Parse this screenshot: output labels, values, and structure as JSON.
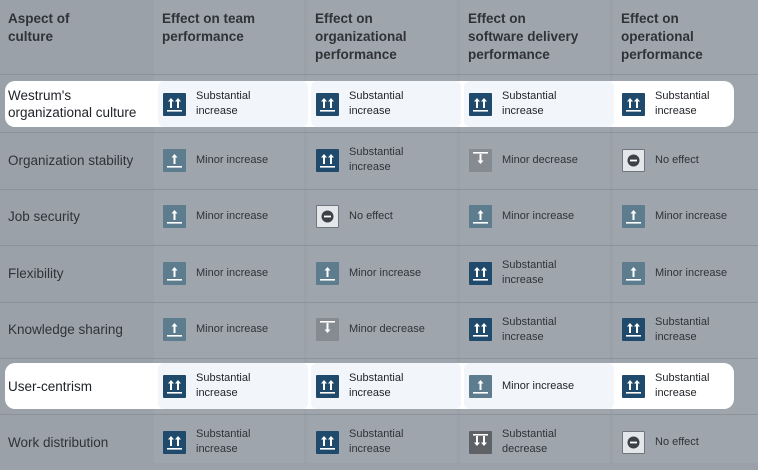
{
  "headers": [
    "Aspect of\nculture",
    "Effect on team\nperformance",
    "Effect on\norganizational\nperformance",
    "Effect on\nsoftware delivery\nperformance",
    "Effect on\noperational\nperformance"
  ],
  "colors": {
    "substantial_increase": "#1f4a6b",
    "minor_increase": "#5d7d8f",
    "minor_decrease": "#868b91",
    "substantial_decrease": "#5e6267",
    "no_effect": "#e4e7ea"
  },
  "rows": [
    {
      "aspect": "Westrum's organizational culture",
      "highlight": true,
      "cells": [
        {
          "label": "Substantial increase",
          "icon": "substantial-increase-icon"
        },
        {
          "label": "Substantial increase",
          "icon": "substantial-increase-icon"
        },
        {
          "label": "Substantial increase",
          "icon": "substantial-increase-icon"
        },
        {
          "label": "Substantial increase",
          "icon": "substantial-increase-icon"
        }
      ]
    },
    {
      "aspect": "Organization stability",
      "highlight": false,
      "cells": [
        {
          "label": "Minor increase",
          "icon": "minor-increase-icon"
        },
        {
          "label": "Substantial increase",
          "icon": "substantial-increase-icon"
        },
        {
          "label": "Minor decrease",
          "icon": "minor-decrease-icon"
        },
        {
          "label": "No effect",
          "icon": "no-effect-icon"
        }
      ]
    },
    {
      "aspect": "Job security",
      "highlight": false,
      "cells": [
        {
          "label": "Minor increase",
          "icon": "minor-increase-icon"
        },
        {
          "label": "No effect",
          "icon": "no-effect-icon"
        },
        {
          "label": "Minor increase",
          "icon": "minor-increase-icon"
        },
        {
          "label": "Minor increase",
          "icon": "minor-increase-icon"
        }
      ]
    },
    {
      "aspect": "Flexibility",
      "highlight": false,
      "cells": [
        {
          "label": "Minor increase",
          "icon": "minor-increase-icon"
        },
        {
          "label": "Minor increase",
          "icon": "minor-increase-icon"
        },
        {
          "label": "Substantial increase",
          "icon": "substantial-increase-icon"
        },
        {
          "label": "Minor increase",
          "icon": "minor-increase-icon"
        }
      ]
    },
    {
      "aspect": "Knowledge sharing",
      "highlight": false,
      "cells": [
        {
          "label": "Minor increase",
          "icon": "minor-increase-icon"
        },
        {
          "label": "Minor decrease",
          "icon": "minor-decrease-icon"
        },
        {
          "label": "Substantial increase",
          "icon": "substantial-increase-icon"
        },
        {
          "label": "Substantial increase",
          "icon": "substantial-increase-icon"
        }
      ]
    },
    {
      "aspect": "User-centrism",
      "highlight": true,
      "cells": [
        {
          "label": "Substantial increase",
          "icon": "substantial-increase-icon"
        },
        {
          "label": "Substantial increase",
          "icon": "substantial-increase-icon"
        },
        {
          "label": "Minor increase",
          "icon": "minor-increase-icon"
        },
        {
          "label": "Substantial increase",
          "icon": "substantial-increase-icon"
        }
      ]
    },
    {
      "aspect": "Work distribution",
      "highlight": false,
      "cells": [
        {
          "label": "Substantial increase",
          "icon": "substantial-increase-icon"
        },
        {
          "label": "Substantial increase",
          "icon": "substantial-increase-icon"
        },
        {
          "label": "Substantial decrease",
          "icon": "substantial-decrease-icon"
        },
        {
          "label": "No effect",
          "icon": "no-effect-icon"
        }
      ]
    }
  ]
}
